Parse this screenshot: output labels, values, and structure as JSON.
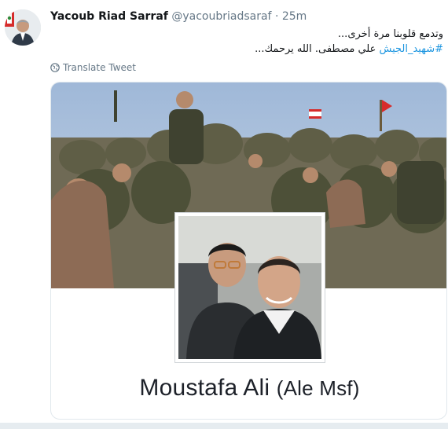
{
  "tweet": {
    "author_name": "Yacoub Riad Sarraf",
    "handle": "@yacoubriadsaraf",
    "separator": "·",
    "time": "25m",
    "text_line1": "وتدمع قلوبنا مرة أخرى...",
    "hashtag": "#شهيد_الجيش",
    "text_line2_rest": " علي مصطفى. الله يرحمك...",
    "translate_label": "Translate Tweet"
  },
  "media": {
    "profile_name": "Moustafa Ali",
    "profile_nickname": "(Ale Msf)"
  },
  "icons": {
    "translate": "globe-icon",
    "avatar": "avatar"
  },
  "colors": {
    "link": "#1b95e0",
    "secondary_text": "#657786",
    "border": "#e1e8ed"
  }
}
